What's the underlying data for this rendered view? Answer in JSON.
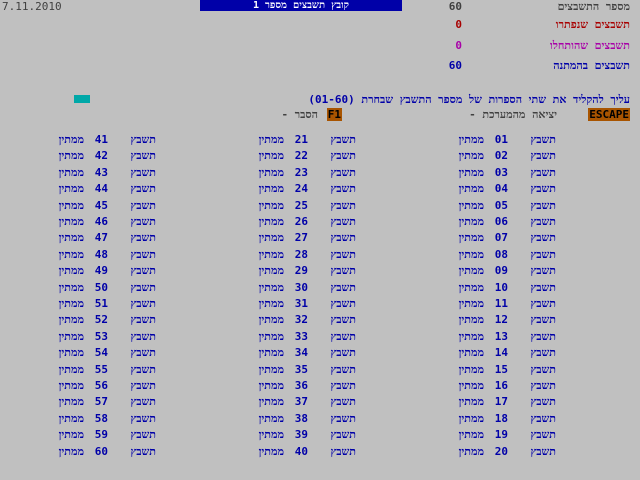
{
  "date": "7.11.2010",
  "header_title": "קובץ תשבצים מספר 1",
  "stats": [
    {
      "label": "מספר התשבצים",
      "value": "60",
      "color": "#404040"
    },
    {
      "label": "תשבצים שנפתרו",
      "value": "0",
      "color": "#a80000"
    },
    {
      "label": "תשבצים שהותחלו",
      "value": "0",
      "color": "#a800a8"
    },
    {
      "label": "תשבצים בהמתנה",
      "value": "60",
      "color": "#0000a8"
    }
  ],
  "instruction": "עליך להקליד את שתי הספרות של מספר התשבץ שבחרת (01-60)",
  "keys": {
    "escape_key": "ESCAPE",
    "escape_label": "- יציאה מהמערכת",
    "f1_key": "F1",
    "f1_label": "- הסבר"
  },
  "file_word": "תשבץ",
  "status_word": "ממתין",
  "files": [
    {
      "num": "01"
    },
    {
      "num": "02"
    },
    {
      "num": "03"
    },
    {
      "num": "04"
    },
    {
      "num": "05"
    },
    {
      "num": "06"
    },
    {
      "num": "07"
    },
    {
      "num": "08"
    },
    {
      "num": "09"
    },
    {
      "num": "10"
    },
    {
      "num": "11"
    },
    {
      "num": "12"
    },
    {
      "num": "13"
    },
    {
      "num": "14"
    },
    {
      "num": "15"
    },
    {
      "num": "16"
    },
    {
      "num": "17"
    },
    {
      "num": "18"
    },
    {
      "num": "19"
    },
    {
      "num": "20"
    },
    {
      "num": "21"
    },
    {
      "num": "22"
    },
    {
      "num": "23"
    },
    {
      "num": "24"
    },
    {
      "num": "25"
    },
    {
      "num": "26"
    },
    {
      "num": "27"
    },
    {
      "num": "28"
    },
    {
      "num": "29"
    },
    {
      "num": "30"
    },
    {
      "num": "31"
    },
    {
      "num": "32"
    },
    {
      "num": "33"
    },
    {
      "num": "34"
    },
    {
      "num": "35"
    },
    {
      "num": "36"
    },
    {
      "num": "37"
    },
    {
      "num": "38"
    },
    {
      "num": "39"
    },
    {
      "num": "40"
    },
    {
      "num": "41"
    },
    {
      "num": "42"
    },
    {
      "num": "43"
    },
    {
      "num": "44"
    },
    {
      "num": "45"
    },
    {
      "num": "46"
    },
    {
      "num": "47"
    },
    {
      "num": "48"
    },
    {
      "num": "49"
    },
    {
      "num": "50"
    },
    {
      "num": "51"
    },
    {
      "num": "52"
    },
    {
      "num": "53"
    },
    {
      "num": "54"
    },
    {
      "num": "55"
    },
    {
      "num": "56"
    },
    {
      "num": "57"
    },
    {
      "num": "58"
    },
    {
      "num": "59"
    },
    {
      "num": "60"
    }
  ]
}
